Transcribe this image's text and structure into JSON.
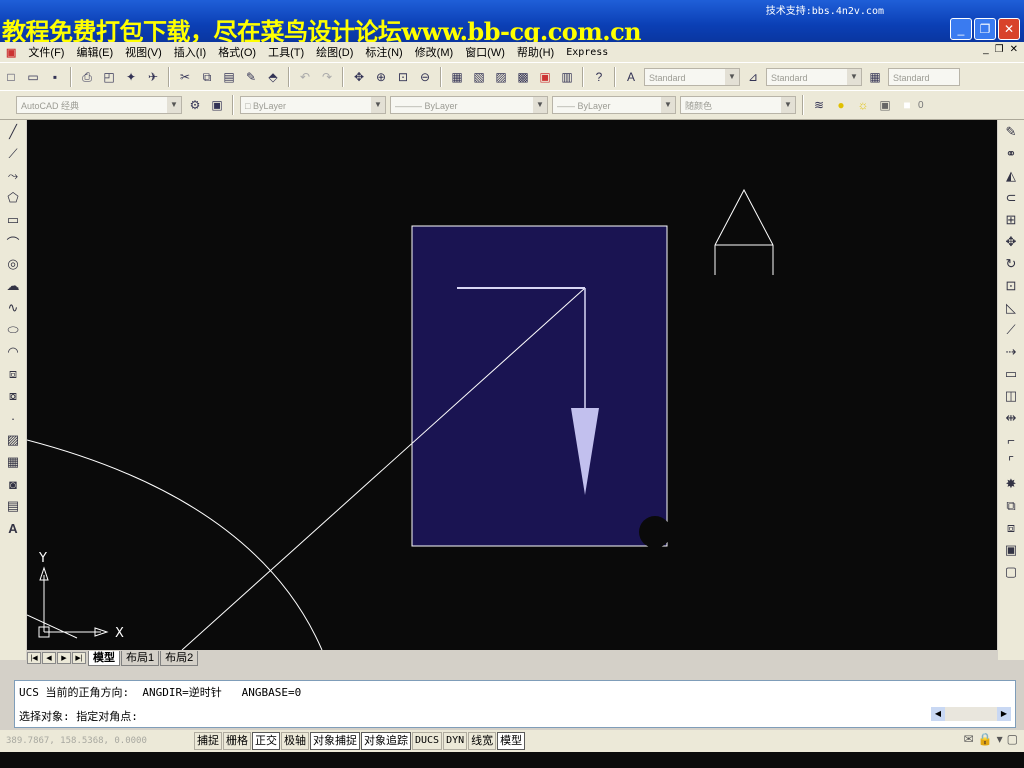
{
  "watermark": "教程免费打包下载，尽在菜鸟设计论坛www.bb-cg.com.cn",
  "support_text": "技术支持:bbs.4n2v.com",
  "window_buttons": {
    "minimize": "_",
    "restore": "❐",
    "close": "✕"
  },
  "menu": [
    "文件(F)",
    "编辑(E)",
    "视图(V)",
    "插入(I)",
    "格式(O)",
    "工具(T)",
    "绘图(D)",
    "标注(N)",
    "修改(M)",
    "窗口(W)",
    "帮助(H)",
    "Express"
  ],
  "mdi_buttons": {
    "minimize": "_",
    "restore": "❐",
    "close": "✕"
  },
  "styles": {
    "text_style": "Standard",
    "dim_style": "Standard",
    "table_style": "Standard"
  },
  "workspace": "AutoCAD 经典",
  "layer_props": {
    "color": "ByLayer",
    "linetype": "ByLayer",
    "lineweight": "ByLayer",
    "plotstyle": "随颜色"
  },
  "current_layer": "0",
  "tabs": [
    "模型",
    "布局1",
    "布局2"
  ],
  "command_history": [
    "UCS 当前的正角方向:  ANGDIR=逆时针   ANGBASE=0",
    "选择对象: 指定对角点:"
  ],
  "coords": "389.7867, 158.5368, 0.0000",
  "status_toggles": [
    {
      "label": "捕捉",
      "on": false
    },
    {
      "label": "栅格",
      "on": false
    },
    {
      "label": "正交",
      "on": true
    },
    {
      "label": "极轴",
      "on": false
    },
    {
      "label": "对象捕捉",
      "on": true
    },
    {
      "label": "对象追踪",
      "on": true
    },
    {
      "label": "DUCS",
      "on": false
    },
    {
      "label": "DYN",
      "on": false
    },
    {
      "label": "线宽",
      "on": false
    },
    {
      "label": "模型",
      "on": true
    }
  ],
  "ucs": {
    "x_label": "X",
    "y_label": "Y"
  },
  "colors": {
    "canvas": "#0a0a0a",
    "selection_window": "#1a1452",
    "arrow": "#c2c0ee",
    "title_blue": "#0b3fb5",
    "watermark": "#ffff00"
  }
}
